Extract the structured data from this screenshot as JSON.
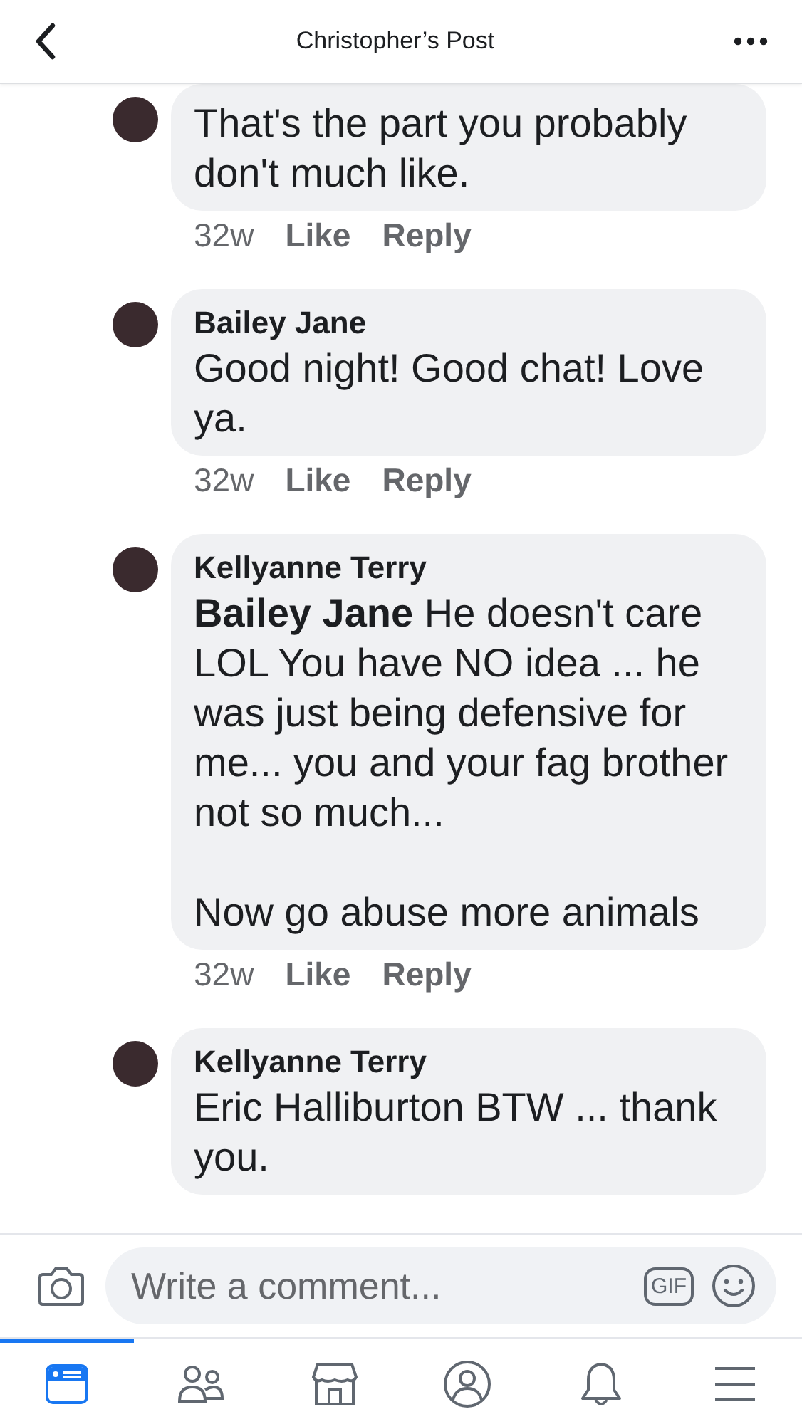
{
  "header": {
    "title": "Christopher’s Post"
  },
  "comments": [
    {
      "body": "That's the part you probably don't much like.",
      "time": "32w",
      "actions": [
        "Like",
        "Reply"
      ]
    },
    {
      "author": "Bailey Jane",
      "body": "Good night! Good chat! Love ya.",
      "time": "32w",
      "actions": [
        "Like",
        "Reply"
      ]
    },
    {
      "author": "Kellyanne Terry",
      "body": "**Bailey Jane** He doesn't care LOL  You have NO idea ... he was just being defensive for me... you and your fag brother not so much...\n\nNow go abuse more animals",
      "time": "32w",
      "actions": [
        "Like",
        "Reply"
      ]
    },
    {
      "author": "Kellyanne Terry",
      "body": "Eric Halliburton BTW ... thank you."
    }
  ],
  "composer": {
    "placeholder": "Write a comment...",
    "gif_label": "GIF"
  },
  "tabs": [
    {
      "kind": "news-feed",
      "selected": true
    },
    {
      "kind": "friends",
      "selected": false
    },
    {
      "kind": "marketplace",
      "selected": false
    },
    {
      "kind": "profile",
      "selected": false
    },
    {
      "kind": "notifications",
      "selected": false
    },
    {
      "kind": "menu",
      "selected": false
    }
  ]
}
